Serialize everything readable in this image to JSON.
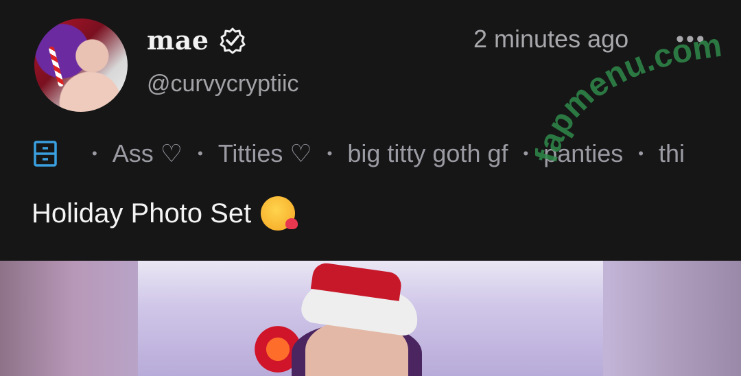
{
  "header": {
    "name": "mae",
    "handle": "@curvycryptiic",
    "timestamp": "2 minutes ago",
    "more_label": "•••"
  },
  "tags": {
    "icon": "archive-drawer-icon",
    "items": [
      "Ass ♡",
      "Titties ♡",
      "big titty goth gf",
      "panties",
      "thi"
    ]
  },
  "post": {
    "title": "Holiday Photo Set",
    "emoji": "kissing-face-emoji"
  },
  "watermark": {
    "text": "fapmenu.com"
  },
  "colors": {
    "background": "#161617",
    "icon_accent": "#3aa0e0",
    "watermark": "#2f8a4a"
  }
}
